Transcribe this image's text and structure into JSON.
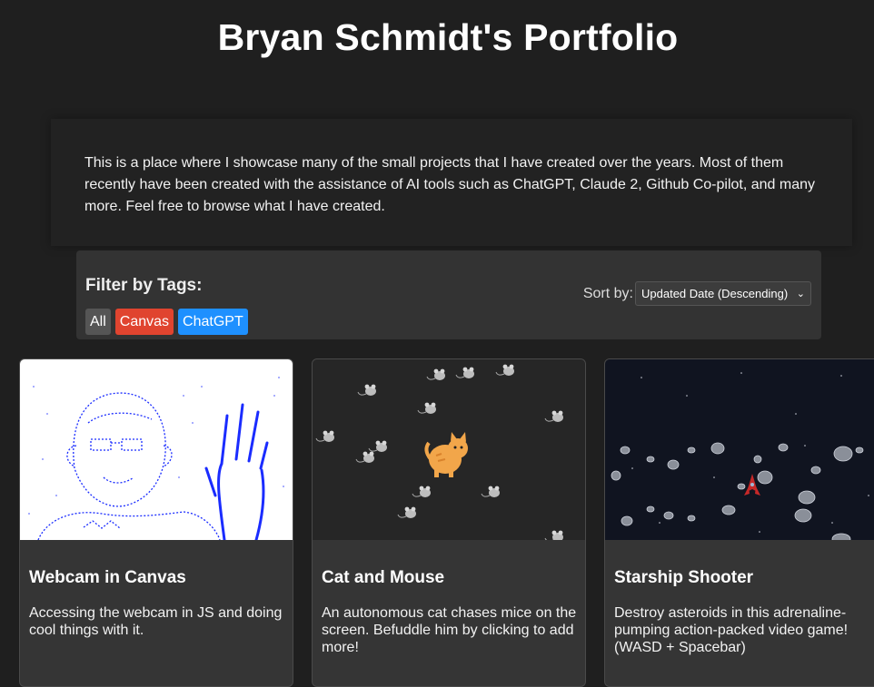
{
  "header": {
    "title": "Bryan Schmidt's Portfolio"
  },
  "intro": {
    "text": "This is a place where I showcase many of the small projects that I have created over the years. Most of them recently have been created with the assistance of AI tools such as ChatGPT, Claude 2, Github Co-pilot, and many more. Feel free to browse what I have created."
  },
  "filter": {
    "title": "Filter by Tags:",
    "tags": [
      {
        "label": "All",
        "color": "#555555"
      },
      {
        "label": "Canvas",
        "color": "#e0442f"
      },
      {
        "label": "ChatGPT",
        "color": "#1e90ff"
      }
    ],
    "sort_label": "Sort by:",
    "sort_value": "Updated Date (Descending)"
  },
  "projects": [
    {
      "title": "Webcam in Canvas",
      "description": "Accessing the webcam in JS and doing cool things with it."
    },
    {
      "title": "Cat and Mouse",
      "description": "An autonomous cat chases mice on the screen. Befuddle him by clicking to add more!"
    },
    {
      "title": "Starship Shooter",
      "description": "Destroy asteroids in this adrenaline-pumping action-packed video game! (WASD + Spacebar)"
    }
  ],
  "colors": {
    "background": "#1f1f1f",
    "panel": "#333333",
    "accent_red": "#e0442f",
    "accent_blue": "#1e90ff",
    "sketch_blue": "#1a2cff"
  }
}
